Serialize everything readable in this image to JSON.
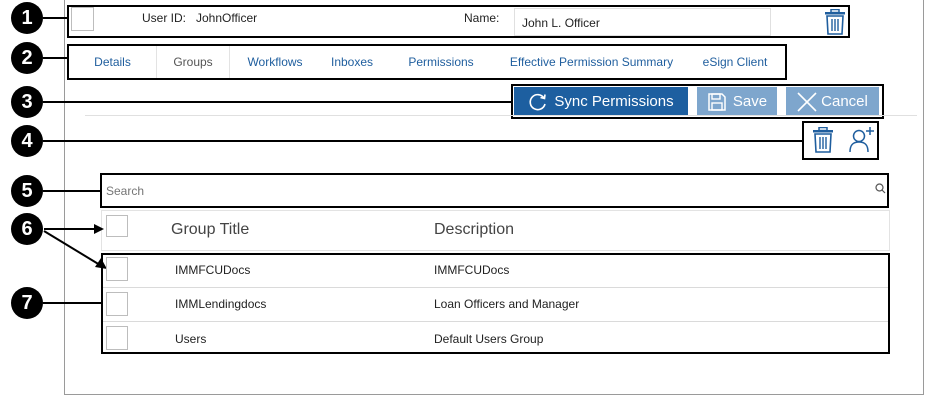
{
  "callouts": [
    "1",
    "2",
    "3",
    "4",
    "5",
    "6",
    "7"
  ],
  "user": {
    "id_label": "User ID:",
    "id_value": "JohnOfficer",
    "name_label": "Name:",
    "name_value": "John L. Officer"
  },
  "tabs": [
    {
      "label": "Details",
      "active": false
    },
    {
      "label": "Groups",
      "active": true
    },
    {
      "label": "Workflows",
      "active": false
    },
    {
      "label": "Inboxes",
      "active": false
    },
    {
      "label": "Permissions",
      "active": false
    },
    {
      "label": "Effective Permission Summary",
      "active": false
    },
    {
      "label": "eSign Client",
      "active": false
    }
  ],
  "actions": {
    "sync_label": "Sync Permissions",
    "save_label": "Save",
    "cancel_label": "Cancel"
  },
  "search": {
    "placeholder": "Search"
  },
  "table": {
    "columns": [
      "Group Title",
      "Description"
    ],
    "rows": [
      {
        "title": "IMMFCUDocs",
        "description": "IMMFCUDocs"
      },
      {
        "title": "IMMLendingdocs",
        "description": "Loan Officers and Manager"
      },
      {
        "title": "Users",
        "description": "Default Users Group"
      }
    ]
  },
  "colors": {
    "accent": "#1f5e9e",
    "sync_bg": "#1d5fa0",
    "secondary_bg": "#7ea6cd",
    "link": "#1f5e9e"
  },
  "icons": [
    "trash-icon",
    "sync-icon",
    "save-icon",
    "close-icon",
    "add-user-icon",
    "search-icon"
  ]
}
